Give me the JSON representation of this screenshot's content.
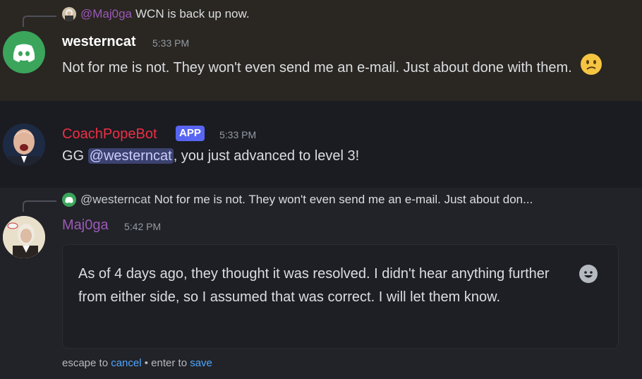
{
  "messages": [
    {
      "reply": {
        "author": "@Maj0ga",
        "text": "WCN is back up now."
      },
      "author": "westerncat",
      "time": "5:33 PM",
      "text": "Not for me is not. They won't even send me an e-mail. Just about done with them.",
      "emoji": "confused-face"
    },
    {
      "author": "CoachPopeBot",
      "badge": "APP",
      "time": "5:33 PM",
      "text_before": "GG ",
      "mention": "@westerncat",
      "text_after": ", you just advanced to level 3!"
    },
    {
      "reply": {
        "author": "@westerncat",
        "text": "Not for me is not. They won't even send me an e-mail. Just about don..."
      },
      "author": "Maj0ga",
      "time": "5:42 PM",
      "edit_text": "As of 4 days ago, they thought it was resolved. I didn't hear anything further from either side, so I assumed that was correct. I will let them know.",
      "hint": {
        "escape": "escape to ",
        "cancel": "cancel",
        "sep": " • enter to ",
        "save": "save"
      }
    }
  ],
  "colors": {
    "westerncat": "#ffffff",
    "coachpopebot": "#ed2f45",
    "maj0ga": "#9b59b6",
    "discord_green": "#3ba55c",
    "link": "#4ea6ff"
  }
}
